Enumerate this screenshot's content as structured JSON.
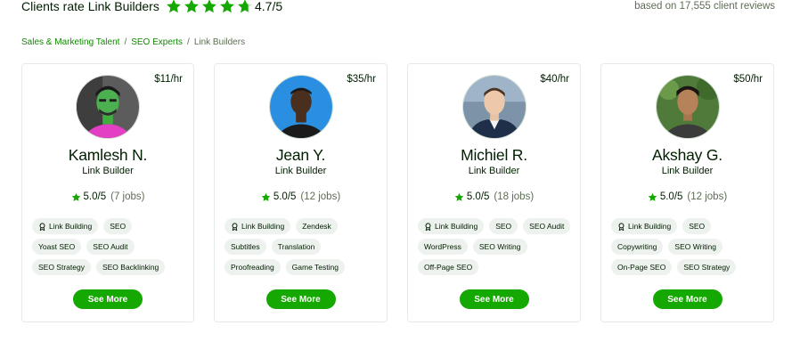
{
  "rating_bar": {
    "title": "Clients rate Link Builders",
    "stars_value": 4.7,
    "score": "4.7/5",
    "reviews": "based on 17,555 client reviews",
    "star_color": "#14a800"
  },
  "breadcrumb": {
    "items": [
      "Sales & Marketing Talent",
      "SEO Experts"
    ],
    "current": "Link Builders",
    "separator": "/"
  },
  "cards": [
    {
      "rate": "$11/hr",
      "name": "Kamlesh N.",
      "role": "Link Builder",
      "score": "5.0/5",
      "jobs": "(7 jobs)",
      "skills": [
        "Link Building",
        "SEO",
        "Yoast SEO",
        "SEO Audit",
        "SEO Strategy",
        "SEO Backlinking"
      ],
      "button": "See More"
    },
    {
      "rate": "$35/hr",
      "name": "Jean Y.",
      "role": "Link Builder",
      "score": "5.0/5",
      "jobs": "(12 jobs)",
      "skills": [
        "Link Building",
        "Zendesk",
        "Subtitles",
        "Translation",
        "Proofreading",
        "Game Testing"
      ],
      "button": "See More"
    },
    {
      "rate": "$40/hr",
      "name": "Michiel R.",
      "role": "Link Builder",
      "score": "5.0/5",
      "jobs": "(18 jobs)",
      "skills": [
        "Link Building",
        "SEO",
        "SEO Audit",
        "WordPress",
        "SEO Writing",
        "Off-Page SEO"
      ],
      "button": "See More"
    },
    {
      "rate": "$50/hr",
      "name": "Akshay G.",
      "role": "Link Builder",
      "score": "5.0/5",
      "jobs": "(12 jobs)",
      "skills": [
        "Link Building",
        "SEO",
        "Copywriting",
        "SEO Writing",
        "On-Page SEO",
        "SEO Strategy"
      ],
      "button": "See More"
    }
  ],
  "icons": {
    "star": "star-icon",
    "badge": "award-badge-icon"
  },
  "colors": {
    "accent": "#14a800",
    "link": "#108a00",
    "chip_bg": "#eef2ee",
    "muted": "#5e6d55"
  }
}
